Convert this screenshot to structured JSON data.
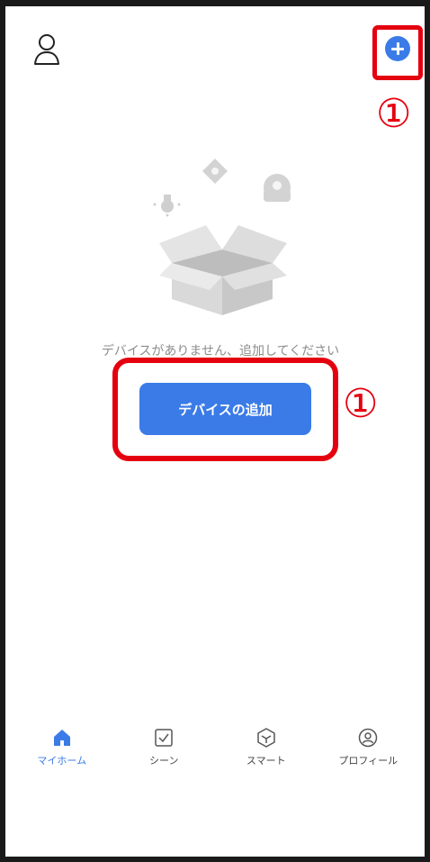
{
  "header": {
    "profile_icon": "user-icon",
    "add_icon": "plus-circle-icon"
  },
  "annotations": {
    "step_marker_top": "①",
    "step_marker_mid": "①",
    "highlight_color": "#e5000f"
  },
  "main": {
    "empty_message": "デバイスがありません、追加してください",
    "add_device_label": "デバイスの追加"
  },
  "bottom_nav": {
    "tabs": [
      {
        "label": "マイホーム",
        "icon": "home-icon",
        "active": true
      },
      {
        "label": "シーン",
        "icon": "checkbox-icon",
        "active": false
      },
      {
        "label": "スマート",
        "icon": "cube-icon",
        "active": false
      },
      {
        "label": "プロフィール",
        "icon": "profile-circle-icon",
        "active": false
      }
    ]
  },
  "colors": {
    "accent": "#3b7be8",
    "frame": "#1a1a1a",
    "muted_text": "#8c8c8c"
  }
}
